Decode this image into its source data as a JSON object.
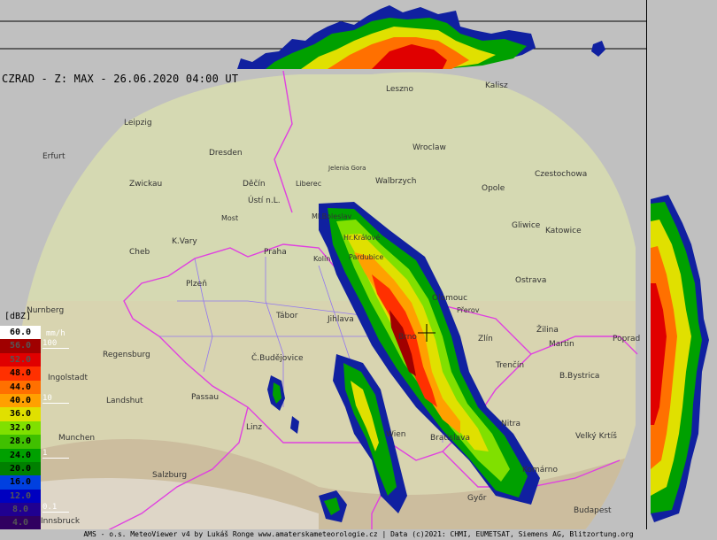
{
  "title": "CZRAD - Z: MAX - 26.06.2020 04:00 UT",
  "footer": "AMS - o.s. MeteoViewer v4 by Lukáš Ronge www.amaterskameteorologie.cz | Data (c)2021: CHMI, EUMETSAT, Siemens AG, Blitzortung.org",
  "legend": {
    "title": "[dBZ]",
    "unit": "mm/h",
    "levels": [
      {
        "dbz": "60.0",
        "color": "#ffffff",
        "text_color": "#000000"
      },
      {
        "dbz": "56.0",
        "color": "#a00000",
        "text_color": "#555555"
      },
      {
        "dbz": "52.0",
        "color": "#e00000",
        "text_color": "#555555"
      },
      {
        "dbz": "48.0",
        "color": "#ff3000",
        "text_color": "#000000"
      },
      {
        "dbz": "44.0",
        "color": "#ff7000",
        "text_color": "#000000"
      },
      {
        "dbz": "40.0",
        "color": "#ffa000",
        "text_color": "#000000"
      },
      {
        "dbz": "36.0",
        "color": "#e0e000",
        "text_color": "#000000"
      },
      {
        "dbz": "32.0",
        "color": "#80e000",
        "text_color": "#000000"
      },
      {
        "dbz": "28.0",
        "color": "#40c000",
        "text_color": "#000000"
      },
      {
        "dbz": "24.0",
        "color": "#00a000",
        "text_color": "#000000"
      },
      {
        "dbz": "20.0",
        "color": "#008000",
        "text_color": "#000000"
      },
      {
        "dbz": "16.0",
        "color": "#0040e0",
        "text_color": "#000000"
      },
      {
        "dbz": "12.0",
        "color": "#0000c0",
        "text_color": "#555555"
      },
      {
        "dbz": "8.0",
        "color": "#200090",
        "text_color": "#555555"
      },
      {
        "dbz": "4.0",
        "color": "#300060",
        "text_color": "#555555"
      }
    ],
    "rates": [
      {
        "label": "100",
        "row": 1
      },
      {
        "label": "10",
        "row": 5
      },
      {
        "label": "1",
        "row": 9
      },
      {
        "label": "0.1",
        "row": 13
      }
    ]
  },
  "cities": [
    {
      "name": "Leszno"
    },
    {
      "name": "Kalisz"
    },
    {
      "name": "Leipzig"
    },
    {
      "name": "Dresden"
    },
    {
      "name": "Wroclaw"
    },
    {
      "name": "Erfurt"
    },
    {
      "name": "Jelenia Gora"
    },
    {
      "name": "Czestochowa"
    },
    {
      "name": "Zwickau"
    },
    {
      "name": "Děčín"
    },
    {
      "name": "Liberec"
    },
    {
      "name": "Walbrzych"
    },
    {
      "name": "Opole"
    },
    {
      "name": "Ústí n.L."
    },
    {
      "name": "Most"
    },
    {
      "name": "Ml.Boleslav"
    },
    {
      "name": "Gliwice"
    },
    {
      "name": "Katowice"
    },
    {
      "name": "K.Vary"
    },
    {
      "name": "Hr.Králové"
    },
    {
      "name": "Praha"
    },
    {
      "name": "Kolín"
    },
    {
      "name": "Pardubice"
    },
    {
      "name": "Cheb"
    },
    {
      "name": "Ostrava"
    },
    {
      "name": "Plzeň"
    },
    {
      "name": "Olomouc"
    },
    {
      "name": "Přerov"
    },
    {
      "name": "Nurnberg"
    },
    {
      "name": "Tábor"
    },
    {
      "name": "Jihlava"
    },
    {
      "name": "Žilina"
    },
    {
      "name": "Brno"
    },
    {
      "name": "Zlín"
    },
    {
      "name": "Martin"
    },
    {
      "name": "Poprad"
    },
    {
      "name": "Regensburg"
    },
    {
      "name": "Č.Budějovice"
    },
    {
      "name": "Trenčín"
    },
    {
      "name": "B.Bystrica"
    },
    {
      "name": "Ingolstadt"
    },
    {
      "name": "Passau"
    },
    {
      "name": "Landshut"
    },
    {
      "name": "Linz"
    },
    {
      "name": "Nitra"
    },
    {
      "name": "Munchen"
    },
    {
      "name": "Wien"
    },
    {
      "name": "Bratislava"
    },
    {
      "name": "Velký Krtíš"
    },
    {
      "name": "Salzburg"
    },
    {
      "name": "Győr"
    },
    {
      "name": "Budapest"
    },
    {
      "name": "Innsbruck"
    },
    {
      "name": "Komárno"
    }
  ]
}
